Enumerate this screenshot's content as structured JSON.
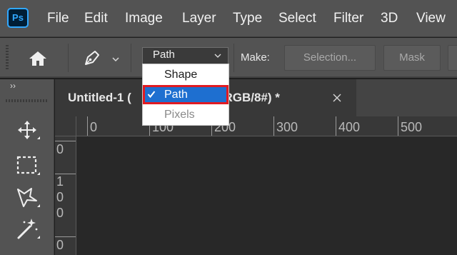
{
  "app": {
    "logo_text": "Ps"
  },
  "menubar": {
    "items": [
      "File",
      "Edit",
      "Image",
      "Layer",
      "Type",
      "Select",
      "Filter",
      "3D",
      "View"
    ]
  },
  "options_bar": {
    "mode_value": "Path",
    "make_label": "Make:",
    "selection_button": "Selection...",
    "mask_button": "Mask"
  },
  "mode_dropdown": {
    "options": [
      {
        "label": "Shape",
        "state": "normal"
      },
      {
        "label": "Path",
        "state": "selected"
      },
      {
        "label": "Pixels",
        "state": "disabled"
      }
    ]
  },
  "toolbar": {
    "collapse_label": "››",
    "tools": [
      "move-tool",
      "marquee-tool",
      "lasso-tool",
      "magic-wand-tool"
    ]
  },
  "document": {
    "tab_title": "Untitled-1 (",
    "tab_title_rest": "er 1, RGB/8#) *"
  },
  "rulers": {
    "horizontal_labels": [
      "0",
      "100",
      "200",
      "300",
      "400",
      "500"
    ],
    "vertical_labels": [
      "0",
      "1",
      "0",
      "0",
      "0"
    ]
  },
  "colors": {
    "panel": "#535353",
    "canvas": "#282828",
    "selected_item": "#1e6fd0",
    "highlight_box": "#e11b22",
    "ps_blue": "#31a8ff"
  }
}
